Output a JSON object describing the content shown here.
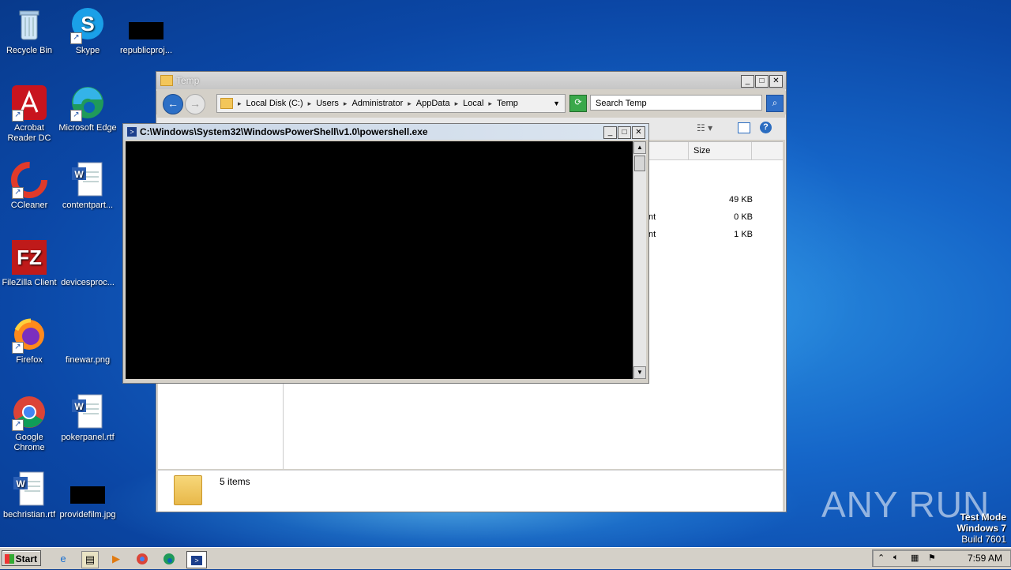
{
  "desktop": {
    "icons": [
      {
        "label": "Recycle Bin"
      },
      {
        "label": "Skype"
      },
      {
        "label": "republicproj..."
      },
      {
        "label": "Acrobat Reader DC"
      },
      {
        "label": "Microsoft Edge"
      },
      {
        "label": "CCleaner"
      },
      {
        "label": "contentpart..."
      },
      {
        "label": "FileZilla Client"
      },
      {
        "label": "devicesproc..."
      },
      {
        "label": "Firefox"
      },
      {
        "label": "finewar.png"
      },
      {
        "label": "Google Chrome"
      },
      {
        "label": "pokerpanel.rtf"
      },
      {
        "label": "bechristian.rtf"
      },
      {
        "label": "providefilm.jpg"
      }
    ]
  },
  "explorer": {
    "title": "Temp",
    "breadcrumbs": [
      "Local Disk (C:)",
      "Users",
      "Administrator",
      "AppData",
      "Local",
      "Temp"
    ],
    "search_placeholder": "Search Temp",
    "columns": {
      "size": "Size"
    },
    "rows": [
      {
        "type": "",
        "size": "49 KB"
      },
      {
        "type": "nt",
        "size": "0 KB"
      },
      {
        "type": "nt",
        "size": "1 KB"
      }
    ],
    "status": "5 items"
  },
  "powershell": {
    "title": "C:\\Windows\\System32\\WindowsPowerShell\\v1.0\\powershell.exe"
  },
  "watermark": {
    "text": "ANY RUN"
  },
  "system": {
    "test_mode": "Test Mode",
    "os": "Windows 7",
    "build": "Build 7601"
  },
  "taskbar": {
    "start_label": "Start",
    "clock": "7:59 AM"
  }
}
